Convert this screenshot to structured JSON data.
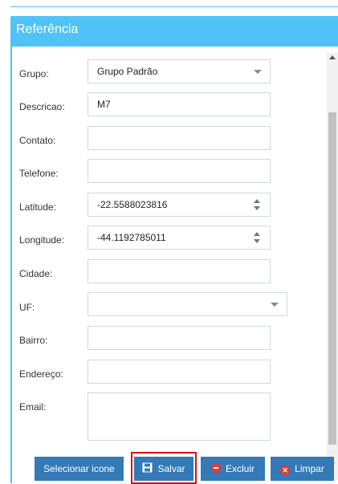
{
  "panel": {
    "title": "Referência"
  },
  "form": {
    "grupo": {
      "label": "Grupo:",
      "value": "Grupo Padrão"
    },
    "descricao": {
      "label": "Descricao:",
      "value": "M7"
    },
    "contato": {
      "label": "Contato:",
      "value": ""
    },
    "telefone": {
      "label": "Telefone:",
      "value": ""
    },
    "latitude": {
      "label": "Latitude:",
      "value": "-22.5588023816"
    },
    "longitude": {
      "label": "Longitude:",
      "value": "-44.1192785011"
    },
    "cidade": {
      "label": "Cidade:",
      "value": ""
    },
    "uf": {
      "label": "UF:",
      "value": ""
    },
    "bairro": {
      "label": "Bairro:",
      "value": ""
    },
    "endereco": {
      "label": "Endereço:",
      "value": ""
    },
    "email": {
      "label": "Email:",
      "value": ""
    }
  },
  "buttons": {
    "selecionar_icone": "Selecionar icone",
    "salvar": "Salvar",
    "excluir": "Excluir",
    "limpar": "Limpar"
  },
  "colors": {
    "header": "#4fc3f7",
    "button": "#337ab7",
    "highlight": "#e01010"
  },
  "icons": {
    "salvar": "floppy-disk-icon",
    "excluir": "minus-circle-icon",
    "limpar": "x-circle-icon"
  }
}
